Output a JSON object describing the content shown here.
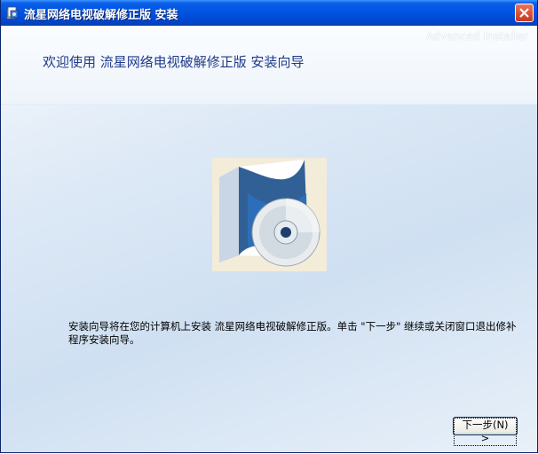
{
  "window": {
    "title": "流星网络电视破解修正版 安装"
  },
  "header": {
    "brand": "Advanced Installer",
    "welcome": "欢迎使用 流星网络电视破解修正版 安装向导"
  },
  "main": {
    "description": "安装向导将在您的计算机上安装 流星网络电视破解修正版。单击 \"下一步\" 继续或关闭窗口退出修补程序安装向导。"
  },
  "buttons": {
    "next": "下一步(N) >"
  },
  "icons": {
    "app": "installer-icon",
    "close": "close-icon",
    "illustration": "software-box-cd-icon"
  },
  "colors": {
    "titlebar": "#0054e3",
    "close": "#c8381c",
    "welcome_text": "#1f3a8a"
  }
}
